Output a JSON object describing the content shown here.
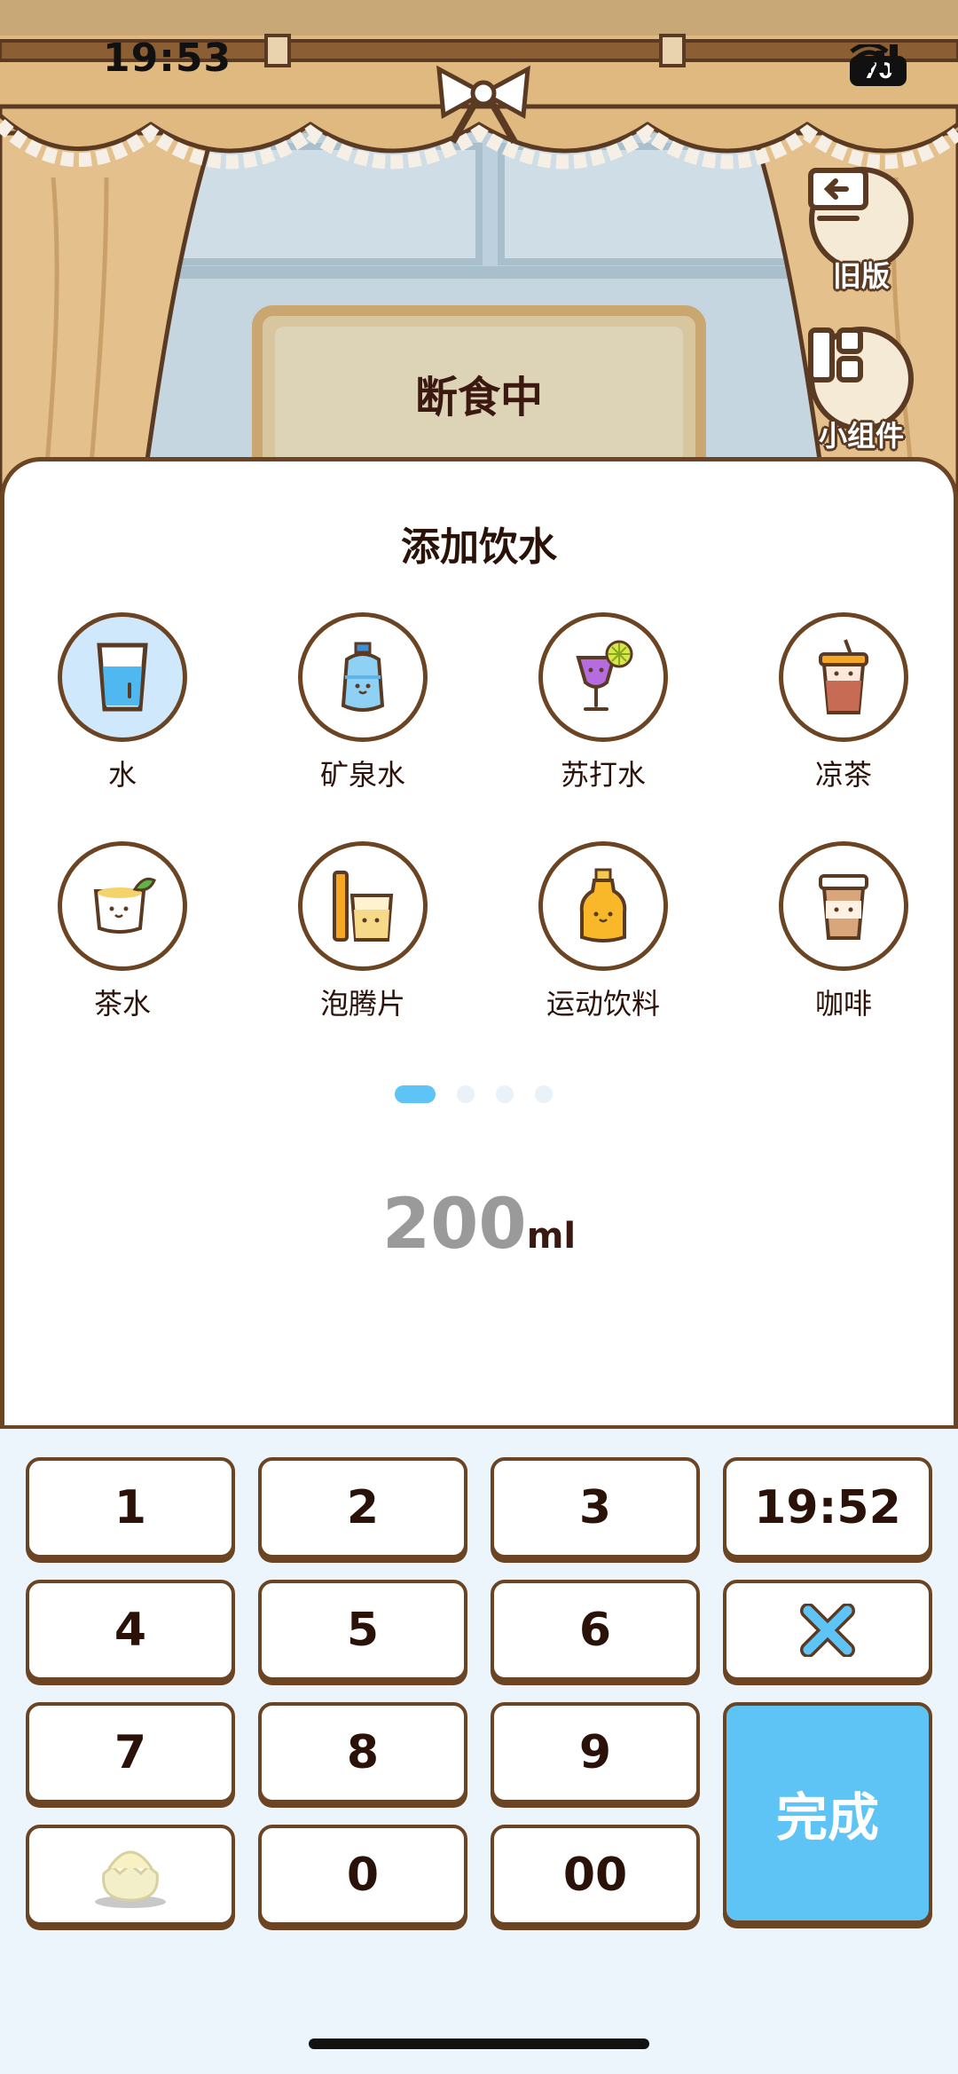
{
  "status_bar": {
    "time": "19:53",
    "battery": "70"
  },
  "scene": {
    "sign_text": "断食中"
  },
  "side_buttons": [
    {
      "label": "旧版",
      "icon": "old-version-icon"
    },
    {
      "label": "小组件",
      "icon": "widget-icon"
    }
  ],
  "sheet": {
    "title": "添加饮水",
    "drinks": [
      {
        "label": "水",
        "icon": "water-glass-icon",
        "selected": true
      },
      {
        "label": "矿泉水",
        "icon": "mineral-water-bottle-icon"
      },
      {
        "label": "苏打水",
        "icon": "soda-glass-icon"
      },
      {
        "label": "凉茶",
        "icon": "herbal-tea-cup-icon"
      },
      {
        "label": "茶水",
        "icon": "tea-cup-icon"
      },
      {
        "label": "泡腾片",
        "icon": "effervescent-tablet-icon"
      },
      {
        "label": "运动饮料",
        "icon": "sports-drink-bottle-icon"
      },
      {
        "label": "咖啡",
        "icon": "coffee-cup-icon"
      }
    ],
    "page_count": 4,
    "current_page": 1,
    "amount": {
      "value": "200",
      "unit": "ml"
    }
  },
  "keypad": {
    "keys": [
      "1",
      "2",
      "3",
      "19:52",
      "4",
      "5",
      "6",
      "",
      "7",
      "8",
      "9",
      "",
      "0",
      "00"
    ],
    "time_key": "19:52",
    "delete_icon": "close-x-icon",
    "mascot_icon": "egg-mascot-icon",
    "done_label": "完成"
  },
  "colors": {
    "accent": "#5ec3f5",
    "outline": "#6b4423",
    "text": "#2b1208"
  }
}
